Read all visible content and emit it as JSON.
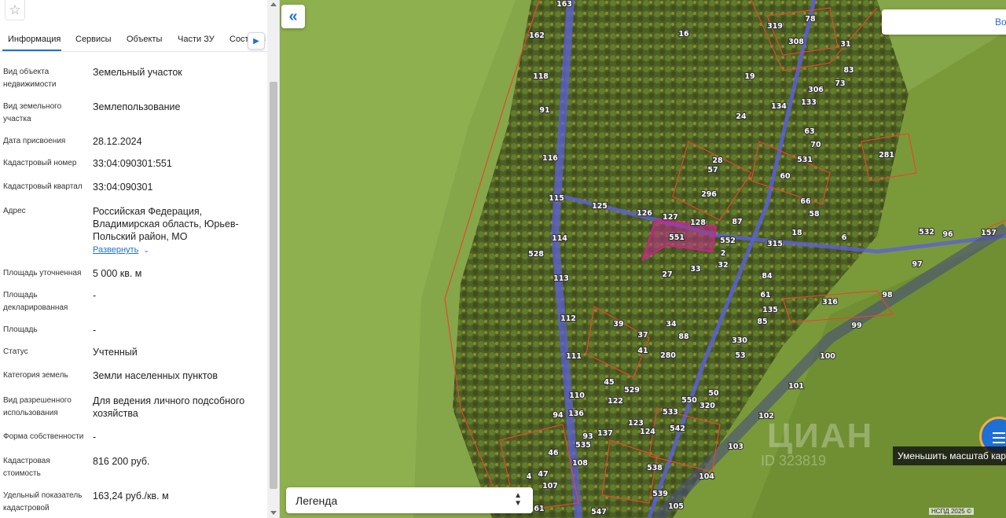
{
  "tabs": [
    {
      "label": "Информация",
      "active": true
    },
    {
      "label": "Сервисы",
      "active": false
    },
    {
      "label": "Объекты",
      "active": false
    },
    {
      "label": "Части ЗУ",
      "active": false
    },
    {
      "label": "Сост",
      "active": false
    }
  ],
  "tabs_overflow_char": "з",
  "fields": [
    {
      "label": "Вид объекта недвижимости",
      "value": "Земельный участок"
    },
    {
      "label": "Вид земельного участка",
      "value": "Землепользование"
    },
    {
      "label": "Дата присвоения",
      "value": "28.12.2024"
    },
    {
      "label": "Кадастровый номер",
      "value": "33:04:090301:551"
    },
    {
      "label": "Кадастровый квартал",
      "value": "33:04:090301"
    },
    {
      "label": "Адрес",
      "value": "Российская Федерация, Владимирская область, Юрьев-Польский район, МО"
    },
    {
      "label": "Площадь уточненная",
      "value": "5 000 кв. м"
    },
    {
      "label": "Площадь декларированная",
      "value": "-"
    },
    {
      "label": "Площадь",
      "value": "-"
    },
    {
      "label": "Статус",
      "value": "Учтенный"
    },
    {
      "label": "Категория земель",
      "value": "Земли населенных пунктов"
    },
    {
      "label": "Вид разрешенного использования",
      "value": "Для ведения личного подсобного хозяйства"
    },
    {
      "label": "Форма собственности",
      "value": "-"
    },
    {
      "label": "Кадастровая стоимость",
      "value": "816 200 руб."
    },
    {
      "label": "Удельный показатель кадастровой",
      "value": "163,24 руб./кв. м"
    }
  ],
  "expand_link": "Развернуть",
  "map": {
    "search_button_label": "Во",
    "legend_label": "Легенда",
    "zoom_tooltip": "Уменьшить масштаб кар",
    "attribution": "НСПД 2025 ©",
    "watermark": "ЦИАН",
    "watermark_id": "ID 323819",
    "selected_parcel": "551",
    "parcel_labels": [
      "163",
      "162",
      "118",
      "91",
      "116",
      "115",
      "114",
      "113",
      "112",
      "111",
      "110",
      "136",
      "94",
      "93",
      "535",
      "137",
      "108",
      "47",
      "46",
      "107",
      "4",
      "61",
      "547",
      "528",
      "125",
      "126",
      "127",
      "128",
      "87",
      "551",
      "552",
      "2",
      "32",
      "33",
      "27",
      "39",
      "37",
      "41",
      "34",
      "88",
      "280",
      "330",
      "53",
      "45",
      "529",
      "122",
      "123",
      "124",
      "533",
      "542",
      "550",
      "320",
      "50",
      "538",
      "539",
      "105",
      "104",
      "103",
      "102",
      "101",
      "100",
      "99",
      "98",
      "97",
      "96",
      "157",
      "532",
      "6",
      "316",
      "84",
      "61",
      "135",
      "85",
      "16",
      "19",
      "134",
      "24",
      "133",
      "319",
      "308",
      "78",
      "31",
      "83",
      "73",
      "306",
      "63",
      "70",
      "531",
      "60",
      "28",
      "57",
      "296",
      "66",
      "58",
      "18",
      "315",
      "281"
    ],
    "colors": {
      "field": "#86a64a",
      "parcel_border": "#e04a2c",
      "selected_fill": "#c02a8a",
      "road": "#5c5fd8"
    }
  }
}
